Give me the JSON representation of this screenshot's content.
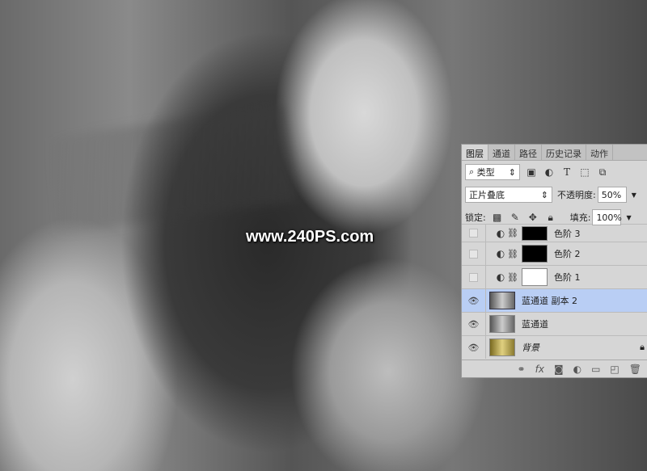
{
  "watermark": "www.240PS.com",
  "panel": {
    "tabs": [
      "图层",
      "通道",
      "路径",
      "历史记录",
      "动作"
    ],
    "filter": {
      "label": "类型",
      "icons": [
        "image-filter-icon",
        "adjustment-filter-icon",
        "type-filter-icon",
        "shape-filter-icon",
        "smart-object-filter-icon"
      ]
    },
    "blend_mode": "正片叠底",
    "opacity_label": "不透明度:",
    "opacity": "50%",
    "lock_label": "锁定:",
    "fill_label": "填充:",
    "fill": "100%",
    "layers": [
      {
        "name": "色阶 3",
        "visible": false,
        "thumb": "#000"
      },
      {
        "name": "色阶 2",
        "visible": false,
        "thumb": "#000"
      },
      {
        "name": "色阶 1",
        "visible": false,
        "thumb": "#fff"
      },
      {
        "name": "蓝通道 副本 2",
        "visible": true,
        "selected": true
      },
      {
        "name": "蓝通道",
        "visible": true
      },
      {
        "name": "背景",
        "visible": true,
        "locked": true
      }
    ]
  }
}
